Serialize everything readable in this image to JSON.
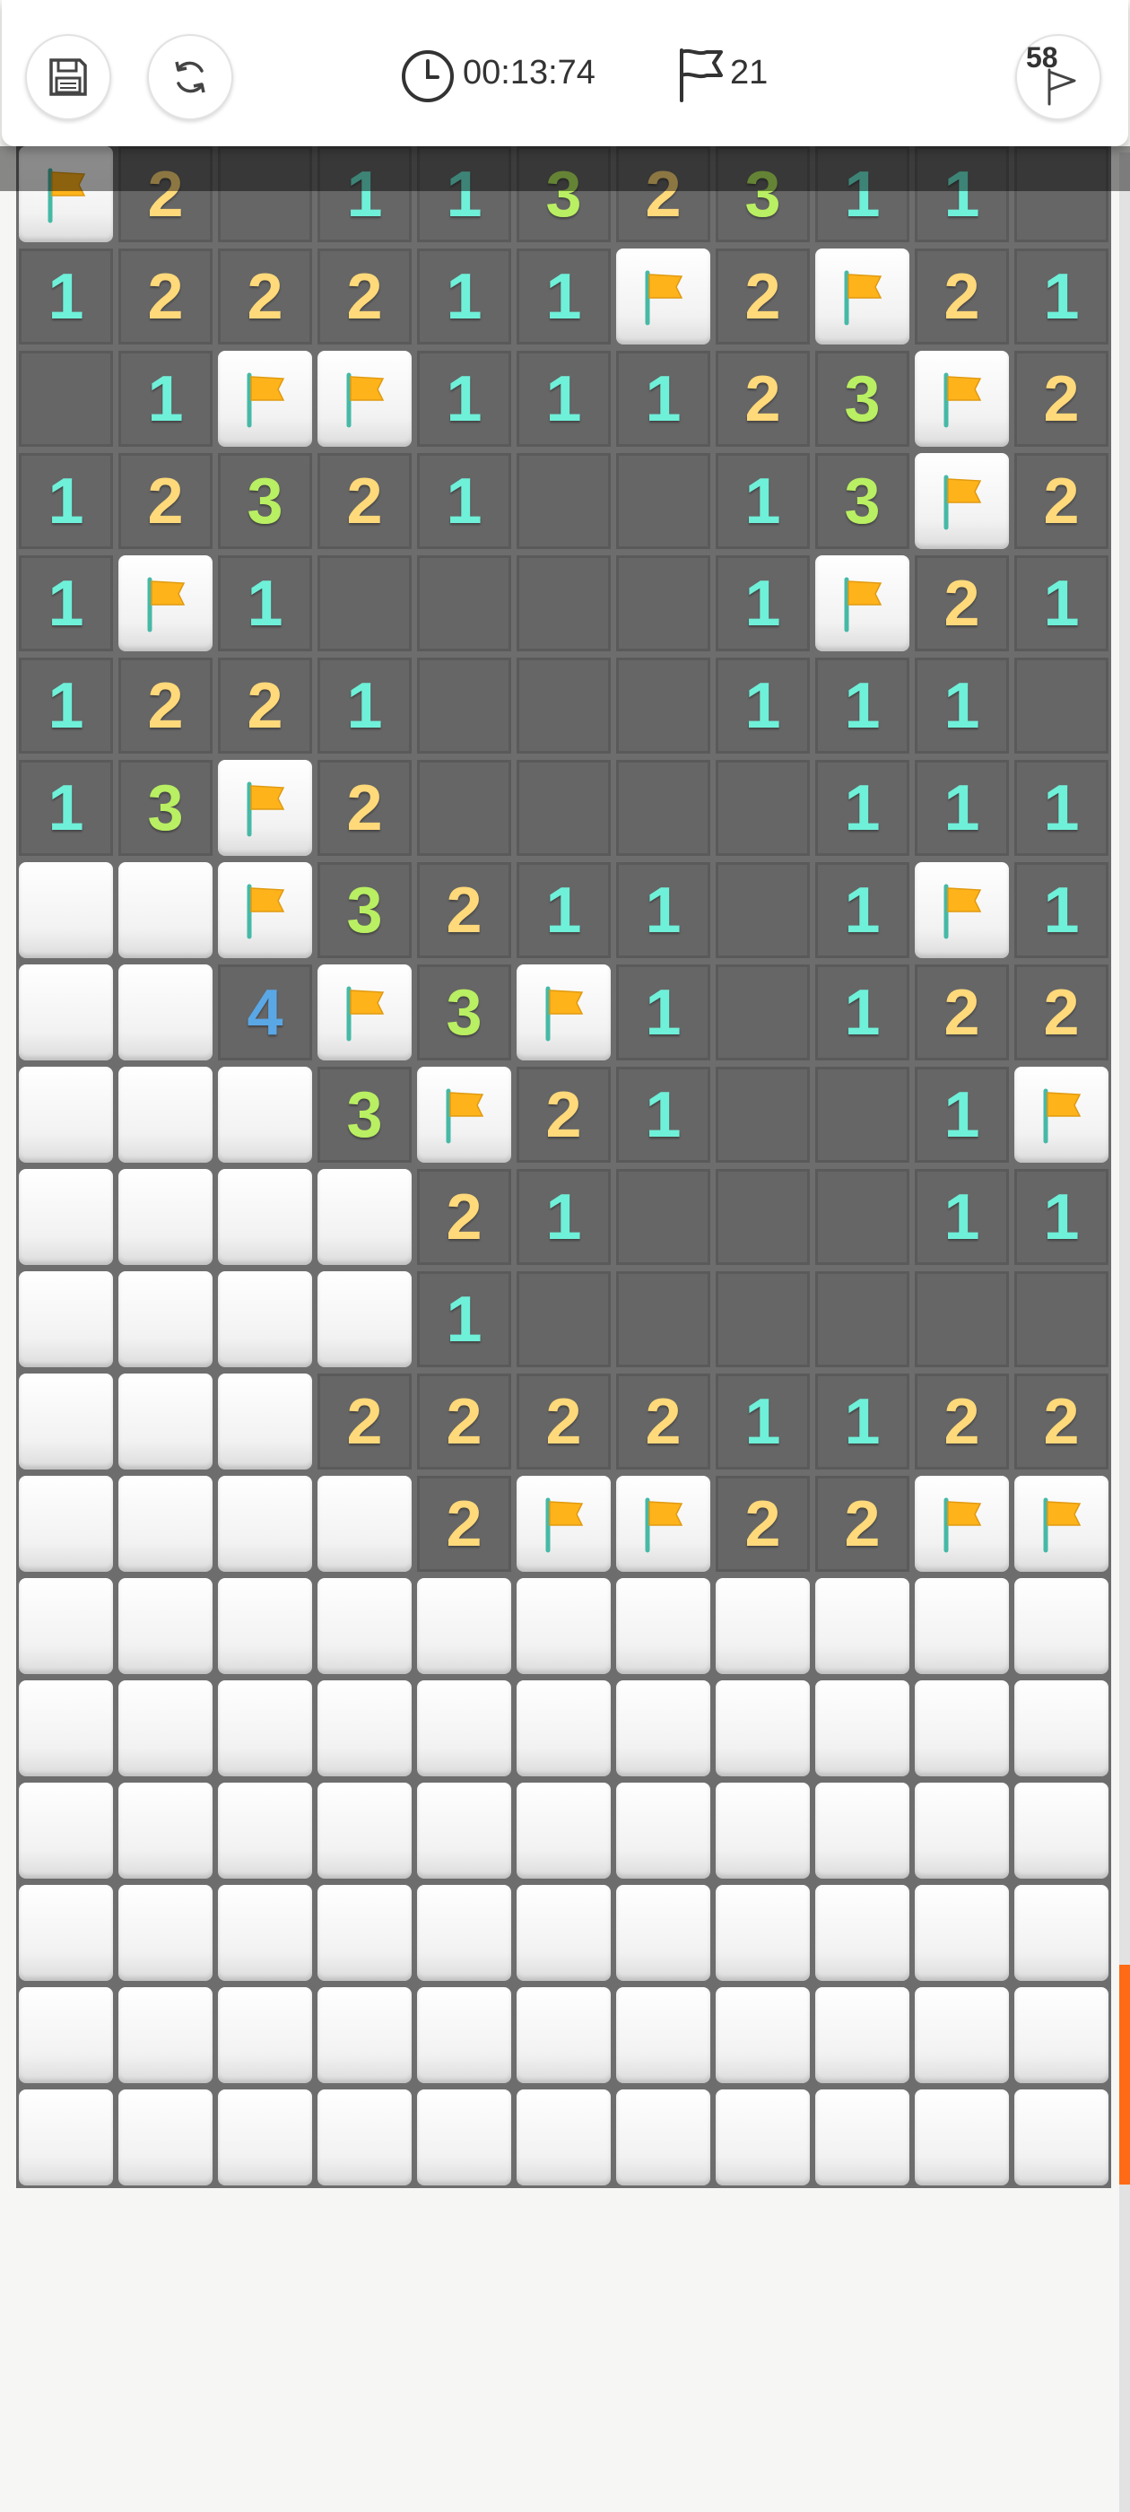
{
  "header": {
    "timer": "00:13:74",
    "flags_remaining": "21",
    "hints_remaining": "58"
  },
  "board": {
    "columns": 11,
    "rows": [
      [
        "F",
        "2",
        "",
        "1",
        "1",
        "3",
        "2",
        "3",
        "1",
        "1",
        ""
      ],
      [
        "1",
        "2",
        "2",
        "2",
        "1",
        "1",
        "F",
        "2",
        "F",
        "2",
        "1"
      ],
      [
        "",
        "1",
        "F",
        "F",
        "1",
        "1",
        "1",
        "2",
        "3",
        "F",
        "2"
      ],
      [
        "1",
        "2",
        "3",
        "2",
        "1",
        "",
        "",
        "1",
        "3",
        "F",
        "2"
      ],
      [
        "1",
        "F",
        "1",
        "",
        "",
        "",
        "",
        "1",
        "F",
        "2",
        "1"
      ],
      [
        "1",
        "2",
        "2",
        "1",
        "",
        "",
        "",
        "1",
        "1",
        "1",
        ""
      ],
      [
        "1",
        "3",
        "F",
        "2",
        "",
        "",
        "",
        "",
        "1",
        "1",
        "1"
      ],
      [
        "C",
        "C",
        "F",
        "3",
        "2",
        "1",
        "1",
        "",
        "1",
        "F",
        "1"
      ],
      [
        "C",
        "C",
        "4",
        "F",
        "3",
        "F",
        "1",
        "",
        "1",
        "2",
        "2"
      ],
      [
        "C",
        "C",
        "C",
        "3",
        "F",
        "2",
        "1",
        "",
        "",
        "1",
        "F"
      ],
      [
        "C",
        "C",
        "C",
        "C",
        "2",
        "1",
        "",
        "",
        "",
        "1",
        "1"
      ],
      [
        "C",
        "C",
        "C",
        "C",
        "1",
        "",
        "",
        "",
        "",
        "",
        ""
      ],
      [
        "C",
        "C",
        "C",
        "2",
        "2",
        "2",
        "2",
        "1",
        "1",
        "2",
        "2"
      ],
      [
        "C",
        "C",
        "C",
        "C",
        "2",
        "F",
        "F",
        "2",
        "2",
        "F",
        "F"
      ],
      [
        "C",
        "C",
        "C",
        "C",
        "C",
        "C",
        "C",
        "C",
        "C",
        "C",
        "C"
      ],
      [
        "C",
        "C",
        "C",
        "C",
        "C",
        "C",
        "C",
        "C",
        "C",
        "C",
        "C"
      ],
      [
        "C",
        "C",
        "C",
        "C",
        "C",
        "C",
        "C",
        "C",
        "C",
        "C",
        "C"
      ],
      [
        "C",
        "C",
        "C",
        "C",
        "C",
        "C",
        "C",
        "C",
        "C",
        "C",
        "C"
      ],
      [
        "C",
        "C",
        "C",
        "C",
        "C",
        "C",
        "C",
        "C",
        "C",
        "C",
        "C"
      ],
      [
        "C",
        "C",
        "C",
        "C",
        "C",
        "C",
        "C",
        "C",
        "C",
        "C",
        "C"
      ]
    ]
  },
  "icons": {
    "save": "floppy-disk-icon",
    "restart": "refresh-icon",
    "timer": "clock-icon",
    "flags": "flag-outline-icon",
    "hint": "flag-hint-icon",
    "cell_flag": "flag-icon"
  },
  "colors": {
    "accent": "#ff6a16",
    "open_cell": "#666666",
    "closed_cell": "#ffffff",
    "number_1": "#6ff0d9",
    "number_2": "#ffd97a",
    "number_3": "#b9ef62",
    "number_4": "#5aa7e6",
    "flag_fill": "#ffb31a",
    "flag_pole": "#46b9a6"
  }
}
